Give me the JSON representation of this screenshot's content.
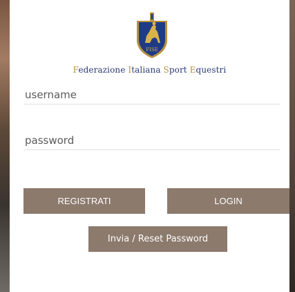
{
  "logo": {
    "icon": "fise-horse-shield-icon",
    "text": "FISE"
  },
  "org": {
    "f": "F",
    "ederazione": "ederazione",
    "i": "I",
    "taliana": "taliana",
    "s": "S",
    "port": "port",
    "e": "E",
    "questri": "questri"
  },
  "form": {
    "username_placeholder": "username",
    "password_placeholder": "password"
  },
  "buttons": {
    "register": "REGISTRATI",
    "login": "LOGIN",
    "reset": "Invia / Reset Password"
  },
  "colors": {
    "button": "#8c7a6d",
    "org_text": "#2b3a74",
    "org_accent": "#b8913a"
  }
}
